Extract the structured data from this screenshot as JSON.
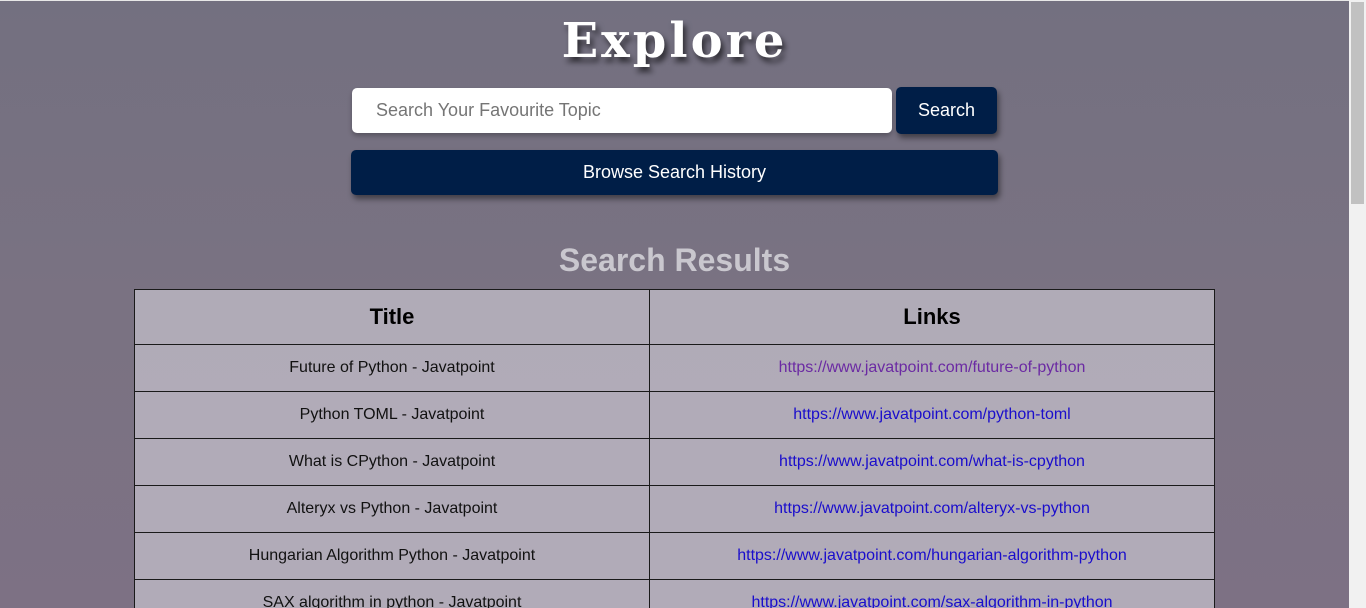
{
  "header": {
    "title": "Explore"
  },
  "search": {
    "placeholder": "Search Your Favourite Topic",
    "value": "",
    "button_label": "Search"
  },
  "history": {
    "button_label": "Browse Search History"
  },
  "results": {
    "heading": "Search Results",
    "columns": [
      "Title",
      "Links"
    ],
    "rows": [
      {
        "title": "Future of Python - Javatpoint",
        "link": "https://www.javatpoint.com/future-of-python"
      },
      {
        "title": "Python TOML - Javatpoint",
        "link": "https://www.javatpoint.com/python-toml"
      },
      {
        "title": "What is CPython - Javatpoint",
        "link": "https://www.javatpoint.com/what-is-cpython"
      },
      {
        "title": "Alteryx vs Python - Javatpoint",
        "link": "https://www.javatpoint.com/alteryx-vs-python"
      },
      {
        "title": "Hungarian Algorithm Python - Javatpoint",
        "link": "https://www.javatpoint.com/hungarian-algorithm-python"
      },
      {
        "title": "SAX algorithm in python - Javatpoint",
        "link": "https://www.javatpoint.com/sax-algorithm-in-python"
      }
    ]
  },
  "colors": {
    "button_bg": "#001e47",
    "link": "#1a0dcc",
    "visited_link": "#6b2aa3",
    "heading": "#c9c7ce"
  }
}
